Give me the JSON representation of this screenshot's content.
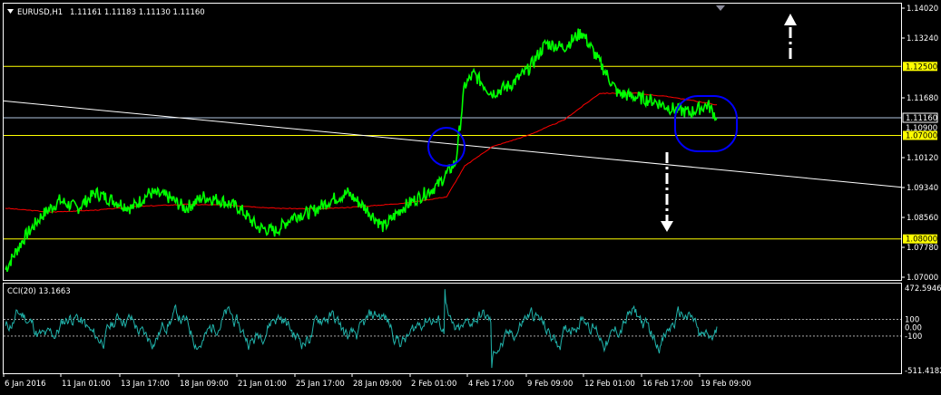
{
  "main_header": {
    "menu_icon": "triangle-down-icon",
    "symbol": "EURUSD,H1",
    "ohlc": "1.11161 1.11183 1.11130 1.11160"
  },
  "indicator_header": "CCI(20) 13.1663",
  "colors": {
    "background": "#000000",
    "frame": "#ffffff",
    "price_line": "#00ff00",
    "moving_average": "#ff0000",
    "level_line": "#ffff00",
    "level_label_bg": "#ffff00",
    "trend_line": "#ffffff",
    "current_price_line": "#b0c4de",
    "circle": "#0000ff",
    "cci_line": "#20b2aa",
    "cci_level": "#c0c0c0"
  },
  "chart_data": [
    {
      "type": "line",
      "name": "EURUSD H1 price chart",
      "ylim": [
        1.07,
        1.1402
      ],
      "y_ticks": [
        "1.14020",
        "1.13240",
        "1.11680",
        "1.10120",
        "1.09340",
        "1.08560",
        "1.07780",
        "1.07000"
      ],
      "horizontal_levels": [
        {
          "value": 1.125,
          "label": "1.12500"
        },
        {
          "value": 1.107,
          "label": "1.07000"
        },
        {
          "value": 1.08,
          "label": "1.08000"
        }
      ],
      "current_price": {
        "value": 1.1116,
        "label": "1.11160"
      },
      "hidden_price_label": "1.10900",
      "x_labels": [
        "6 Jan 2016",
        "11 Jan 01:00",
        "13 Jan 17:00",
        "18 Jan 09:00",
        "21 Jan 01:00",
        "25 Jan 17:00",
        "28 Jan 09:00",
        "2 Feb 01:00",
        "4 Feb 17:00",
        "9 Feb 09:00",
        "12 Feb 01:00",
        "16 Feb 17:00",
        "19 Feb 09:00"
      ],
      "price_series": {
        "index": [
          0,
          20,
          40,
          60,
          80,
          100,
          120,
          140,
          160,
          180,
          200,
          220,
          240,
          260,
          280,
          300,
          320,
          340,
          360,
          380,
          400,
          420,
          440,
          460,
          480,
          500,
          510,
          520,
          540,
          560,
          580,
          600,
          620,
          640,
          660,
          680,
          700,
          720,
          740,
          760,
          780,
          790
        ],
        "values": [
          1.072,
          1.08,
          1.086,
          1.09,
          1.088,
          1.092,
          1.09,
          1.088,
          1.092,
          1.091,
          1.088,
          1.091,
          1.09,
          1.088,
          1.083,
          1.082,
          1.086,
          1.087,
          1.09,
          1.092,
          1.088,
          1.083,
          1.088,
          1.091,
          1.094,
          1.1,
          1.12,
          1.123,
          1.118,
          1.12,
          1.124,
          1.131,
          1.13,
          1.134,
          1.126,
          1.118,
          1.117,
          1.116,
          1.114,
          1.113,
          1.115,
          1.1116
        ]
      },
      "moving_average": {
        "index": [
          0,
          50,
          100,
          150,
          200,
          250,
          300,
          350,
          400,
          450,
          490,
          510,
          540,
          580,
          620,
          660,
          700,
          740,
          790
        ],
        "values": [
          1.088,
          1.087,
          1.0875,
          1.0885,
          1.089,
          1.0888,
          1.088,
          1.0878,
          1.0885,
          1.0895,
          1.091,
          1.099,
          1.104,
          1.107,
          1.111,
          1.118,
          1.118,
          1.117,
          1.115
        ]
      },
      "trend_line": {
        "start": 1.116,
        "end": 1.0935
      }
    },
    {
      "type": "line",
      "name": "CCI(20)",
      "ylim": [
        -511.4182,
        472.5946
      ],
      "y_ticks": [
        "472.5946",
        "100",
        "0.00",
        "-100",
        "-511.4182"
      ],
      "levels": [
        100,
        -100
      ],
      "last_value": 13.1663
    }
  ]
}
